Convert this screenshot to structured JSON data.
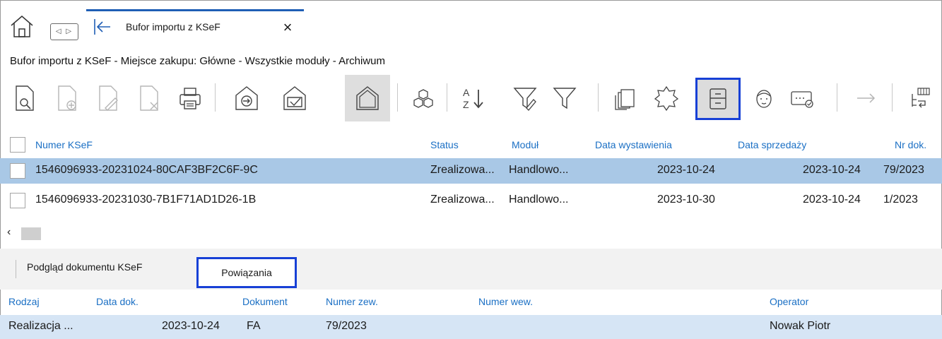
{
  "tab": {
    "title": "Bufor importu z KSeF",
    "close_glyph": "×"
  },
  "nav_arrows": "◁ ▷",
  "breadcrumb": "Bufor importu z KSeF - Miejsce zakupu: Główne - Wszystkie moduły - Archiwum",
  "toolbar": {
    "icons": [
      "preview-document-icon",
      "add-document-icon",
      "edit-document-icon",
      "delete-document-icon",
      "print-icon",
      "import-icon",
      "approve-icon",
      "warehouse-icon",
      "components-icon",
      "sort-az-icon",
      "filter-edit-icon",
      "filter-icon",
      "copy-columns-icon",
      "badge-icon",
      "archive-cabinet-icon",
      "user-face-icon",
      "card-check-icon",
      "arrow-right-icon",
      "columns-settings-icon"
    ],
    "highlight_color": "#1740d6"
  },
  "grid": {
    "columns": [
      "Numer KSeF",
      "Status",
      "Moduł",
      "Data wystawienia",
      "Data sprzedaży",
      "Nr dok."
    ],
    "rows": [
      {
        "numer": "1546096933-20231024-80CAF3BF2C6F-9C",
        "status": "Zrealizowa...",
        "modul": "Handlowo...",
        "data_wyst": "2023-10-24",
        "data_sprz": "2023-10-24",
        "nr_dok": "79/2023",
        "selected": true
      },
      {
        "numer": "1546096933-20231030-7B1F71AD1D26-1B",
        "status": "Zrealizowa...",
        "modul": "Handlowo...",
        "data_wyst": "2023-10-30",
        "data_sprz": "2023-10-24",
        "nr_dok": "1/2023",
        "selected": false
      }
    ],
    "scroll_left_glyph": "‹"
  },
  "lower_tabs": [
    "Podgląd dokumentu KSeF",
    "Powiązania"
  ],
  "sub_grid": {
    "columns": [
      "Rodzaj",
      "Data dok.",
      "Dokument",
      "Numer zew.",
      "Numer wew.",
      "Operator"
    ],
    "row": {
      "rodzaj": "Realizacja ...",
      "data_dok": "2023-10-24",
      "dokument": "FA",
      "numer_zew": "79/2023",
      "numer_wew": "",
      "operator": "Nowak Piotr"
    }
  },
  "colors": {
    "header_text": "#1a6fc4",
    "selected_row": "#a9c8e6",
    "sub_row": "#d6e5f5",
    "tab_accent": "#1f5eb5"
  }
}
